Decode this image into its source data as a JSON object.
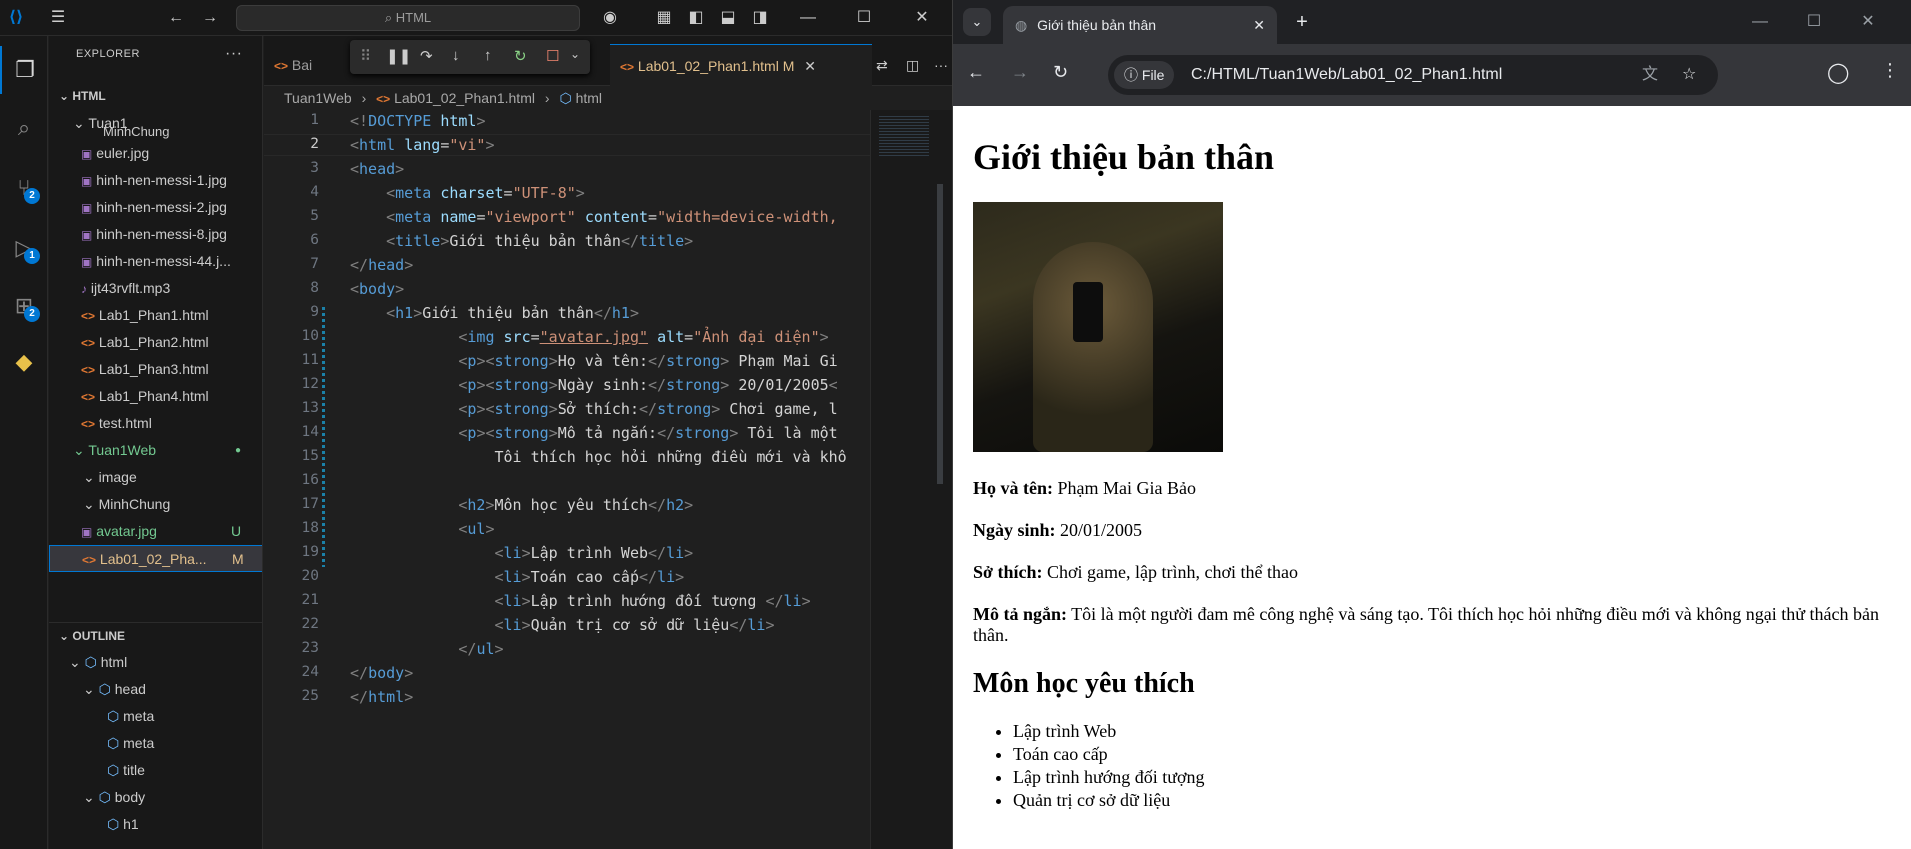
{
  "vscode": {
    "search_placeholder": "HTML",
    "explorer_label": "EXPLORER",
    "root_folder": "HTML",
    "folder_tuan1": "Tuan1",
    "files": [
      {
        "name": "MinhChung",
        "type": "folder-partial"
      },
      {
        "name": "euler.jpg",
        "type": "img"
      },
      {
        "name": "hinh-nen-messi-1.jpg",
        "type": "img"
      },
      {
        "name": "hinh-nen-messi-2.jpg",
        "type": "img"
      },
      {
        "name": "hinh-nen-messi-8.jpg",
        "type": "img"
      },
      {
        "name": "hinh-nen-messi-44.j...",
        "type": "img"
      },
      {
        "name": "ijt43rvflt.mp3",
        "type": "mp3"
      },
      {
        "name": "Lab1_Phan1.html",
        "type": "html"
      },
      {
        "name": "Lab1_Phan2.html",
        "type": "html"
      },
      {
        "name": "Lab1_Phan3.html",
        "type": "html"
      },
      {
        "name": "Lab1_Phan4.html",
        "type": "html"
      },
      {
        "name": "test.html",
        "type": "html"
      }
    ],
    "folder_tuan1web": "Tuan1Web",
    "sub_image": "image",
    "sub_minhchung": "MinhChung",
    "avatar_file": "avatar.jpg",
    "avatar_status": "U",
    "lab_file": "Lab01_02_Pha...",
    "lab_status": "M",
    "outline_label": "OUTLINE",
    "outline": [
      "html",
      "head",
      "meta",
      "meta",
      "title",
      "body",
      "h1"
    ],
    "tab_partial": "Bai",
    "active_tab": "Lab01_02_Phan1.html",
    "active_tab_status": "M",
    "breadcrumb": [
      "Tuan1Web",
      "Lab01_02_Phan1.html",
      "html"
    ],
    "badges": {
      "scm": "2",
      "debug": "1",
      "extensions": "2"
    },
    "line_numbers": [
      "1",
      "2",
      "3",
      "4",
      "5",
      "6",
      "7",
      "8",
      "9",
      "10",
      "11",
      "12",
      "13",
      "14",
      "15",
      "16",
      "17",
      "18",
      "19",
      "20",
      "21",
      "22",
      "23",
      "24",
      "25"
    ]
  },
  "chrome": {
    "tab_title": "Giới thiệu bản thân",
    "file_chip": "File",
    "url": "C:/HTML/Tuan1Web/Lab01_02_Phan1.html",
    "page": {
      "h1": "Giới thiệu bản thân",
      "name_label": "Họ và tên:",
      "name_value": " Phạm Mai Gia Bảo",
      "dob_label": "Ngày sinh:",
      "dob_value": " 20/01/2005",
      "hobby_label": "Sở thích:",
      "hobby_value": " Chơi game, lập trình, chơi thể thao",
      "desc_label": "Mô tả ngắn:",
      "desc_value": " Tôi là một người đam mê công nghệ và sáng tạo. Tôi thích học hỏi những điều mới và không ngại thử thách bản thân.",
      "h2": "Môn học yêu thích",
      "subjects": [
        "Lập trình Web",
        "Toán cao cấp",
        "Lập trình hướng đối tượng",
        "Quản trị cơ sở dữ liệu"
      ]
    }
  }
}
